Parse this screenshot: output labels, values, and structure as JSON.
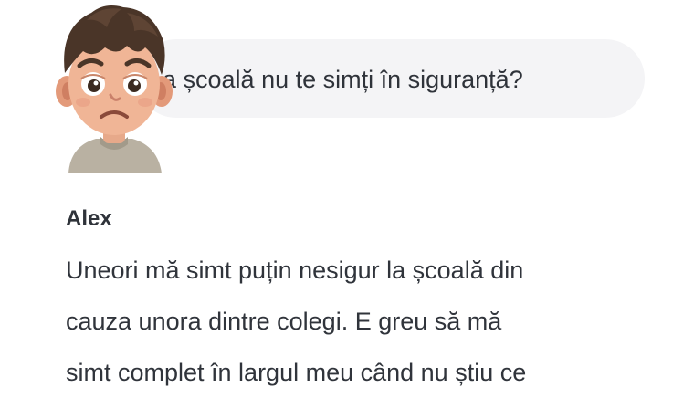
{
  "conversation": {
    "user_message": "a școală nu te simți în siguranță?",
    "assistant": {
      "name": "Alex",
      "message_lines": [
        "Uneori mă simt puțin nesigur la școală din",
        "cauza unora dintre colegi. E greu să mă",
        "simt complet în largul meu când nu știu ce"
      ]
    },
    "avatar": "worried-boy-avatar-icon"
  },
  "colors": {
    "bubble_bg": "#f4f4f6",
    "text": "#2f333a",
    "background": "#ffffff"
  }
}
